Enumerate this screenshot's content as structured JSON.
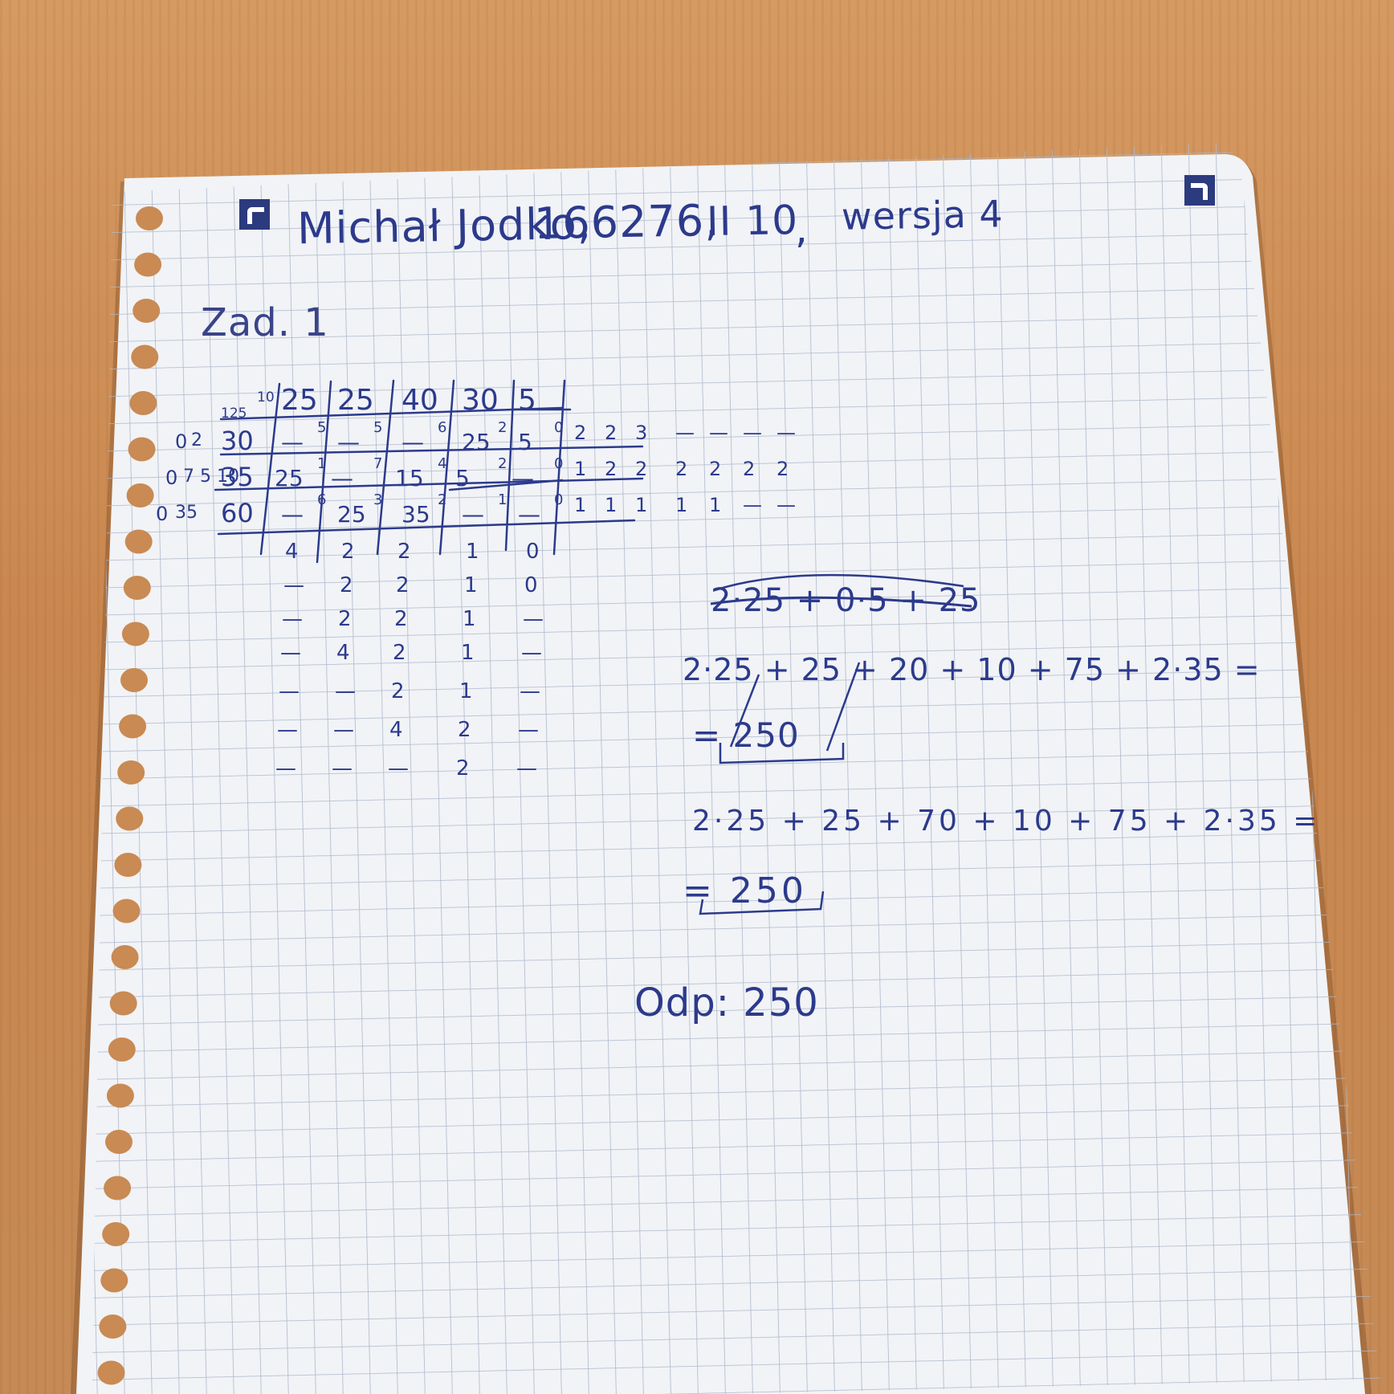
{
  "header": {
    "name": "Michał Jodko,",
    "student_id": "166276,",
    "group": "II 10",
    "comma": ",",
    "version": "wersja 4"
  },
  "task_label": "Zad. 1",
  "table": {
    "corner_demand": "10",
    "corner_supply": "125",
    "demand": [
      "25",
      "25",
      "40",
      "30",
      "5"
    ],
    "rows": [
      {
        "potential": "0",
        "struck": "2",
        "supply": "30",
        "cells": [
          [
            "—",
            "5"
          ],
          [
            "—",
            "5"
          ],
          [
            "—",
            "6"
          ],
          [
            "25",
            "2"
          ],
          [
            "5",
            "0"
          ]
        ],
        "penalties": [
          "2",
          "2",
          "3",
          "—",
          "—",
          "—",
          "—"
        ]
      },
      {
        "potential": "0",
        "struck": "7 5 10",
        "supply": "35",
        "cells": [
          [
            "25",
            "1"
          ],
          [
            "—",
            "7"
          ],
          [
            "15",
            "4"
          ],
          [
            "5",
            "2"
          ],
          [
            "—",
            "0"
          ]
        ],
        "penalties": [
          "1",
          "2",
          "2",
          "2",
          "2",
          "2",
          "2"
        ]
      },
      {
        "potential": "0",
        "struck": "35",
        "supply": "60",
        "cells": [
          [
            "—",
            "6"
          ],
          [
            "25",
            "3"
          ],
          [
            "35",
            "2"
          ],
          [
            "—",
            "1"
          ],
          [
            "—",
            "0"
          ]
        ],
        "penalties": [
          "1",
          "1",
          "1",
          "1",
          "1",
          "—",
          "—"
        ]
      }
    ],
    "column_penalties": [
      [
        "4",
        "2",
        "2",
        "1",
        "0"
      ],
      [
        "—",
        "2",
        "2",
        "1",
        "0"
      ],
      [
        "—",
        "2",
        "2",
        "1",
        "—"
      ],
      [
        "—",
        "4",
        "2",
        "1",
        "—"
      ],
      [
        "—",
        "—",
        "2",
        "1",
        "—"
      ],
      [
        "—",
        "—",
        "4",
        "2",
        "—"
      ],
      [
        "—",
        "—",
        "—",
        "2",
        "—"
      ]
    ]
  },
  "calc": {
    "crossed_line": "2·25 + 0·5 + 25",
    "line1": "2·25 + 25 + 20 + 10 + 75 + 2·35 =",
    "line1_result": "= 250",
    "line2": "2·25 + 25 + 70 + 10 + 75 + 2·35 =",
    "line2_result": "= 250",
    "answer": "Odp: 250"
  },
  "colors": {
    "ink": "#2c3a8c",
    "paper": "#f2f4f7",
    "grid": "#aab4c8",
    "desk": "#c98a53",
    "mark": "#2c3b7e"
  }
}
